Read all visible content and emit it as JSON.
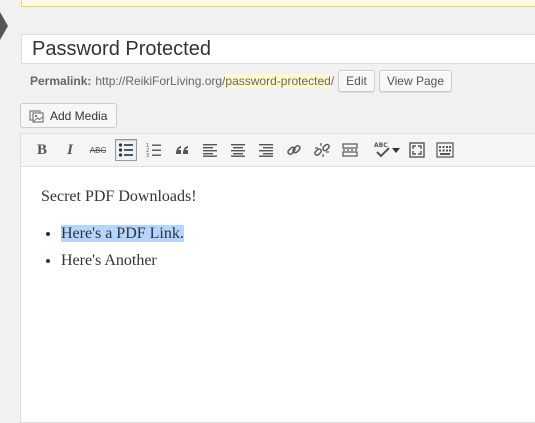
{
  "post": {
    "title": "Password Protected",
    "permalink_label": "Permalink:",
    "permalink_base": "http://ReikiForLiving.org/",
    "permalink_slug": "password-protected",
    "permalink_trailing": "/",
    "edit_label": "Edit",
    "view_page_label": "View Page"
  },
  "media": {
    "add_media_label": "Add Media"
  },
  "toolbar": {
    "bold": "B",
    "italic": "I",
    "strike": "ABC",
    "spellcheck": "ABC",
    "icons": [
      "bold-icon",
      "italic-icon",
      "strikethrough-icon",
      "bullet-list-icon",
      "numbered-list-icon",
      "blockquote-icon",
      "align-left-icon",
      "align-center-icon",
      "align-right-icon",
      "insert-link-icon",
      "unlink-icon",
      "read-more-icon",
      "spellcheck-icon",
      "fullscreen-icon",
      "kitchen-sink-icon"
    ]
  },
  "content": {
    "heading_line": "Secret PDF Downloads!",
    "list": [
      "Here's a PDF Link.",
      "Here's Another"
    ]
  },
  "colors": {
    "selection": "#b4d5fe",
    "slug_highlight": "#fffbcc",
    "notice_border": "#e6db55"
  }
}
